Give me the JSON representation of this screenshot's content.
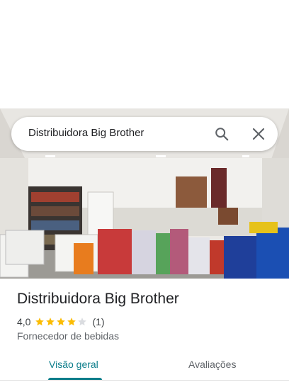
{
  "search": {
    "query": "Distribuidora Big Brother"
  },
  "place": {
    "name": "Distribuidora Big Brother",
    "rating": "4,0",
    "rating_value": 4.0,
    "rating_max": 5,
    "review_count": "(1)",
    "category": "Fornecedor de bebidas"
  },
  "tabs": [
    {
      "label": "Visão geral",
      "active": true
    },
    {
      "label": "Avaliações",
      "active": false
    }
  ],
  "colors": {
    "accent": "#0b7d8a",
    "star": "#fbbc04",
    "star_empty": "#dadce0"
  },
  "icons": [
    "search-icon",
    "close-icon",
    "star-icon"
  ]
}
